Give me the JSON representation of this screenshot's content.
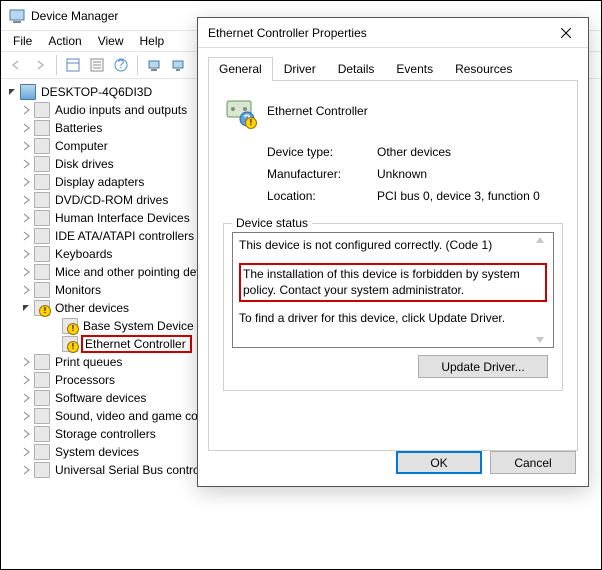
{
  "dm": {
    "title": "Device Manager",
    "menu": {
      "file": "File",
      "action": "Action",
      "view": "View",
      "help": "Help"
    },
    "root": "DESKTOP-4Q6DI3D",
    "nodes": [
      {
        "label": "Audio inputs and outputs"
      },
      {
        "label": "Batteries"
      },
      {
        "label": "Computer"
      },
      {
        "label": "Disk drives"
      },
      {
        "label": "Display adapters"
      },
      {
        "label": "DVD/CD-ROM drives"
      },
      {
        "label": "Human Interface Devices"
      },
      {
        "label": "IDE ATA/ATAPI controllers"
      },
      {
        "label": "Keyboards"
      },
      {
        "label": "Mice and other pointing devices"
      },
      {
        "label": "Monitors"
      },
      {
        "label": "Other devices",
        "expanded": true,
        "children": [
          {
            "label": "Base System Device"
          },
          {
            "label": "Ethernet Controller",
            "highlight": true
          }
        ]
      },
      {
        "label": "Print queues"
      },
      {
        "label": "Processors"
      },
      {
        "label": "Software devices"
      },
      {
        "label": "Sound, video and game controllers"
      },
      {
        "label": "Storage controllers"
      },
      {
        "label": "System devices"
      },
      {
        "label": "Universal Serial Bus controllers"
      }
    ]
  },
  "dlg": {
    "title": "Ethernet Controller Properties",
    "tabs": {
      "general": "General",
      "driver": "Driver",
      "details": "Details",
      "events": "Events",
      "resources": "Resources"
    },
    "device_name": "Ethernet Controller",
    "info": {
      "type_label": "Device type:",
      "type_value": "Other devices",
      "mfg_label": "Manufacturer:",
      "mfg_value": "Unknown",
      "loc_label": "Location:",
      "loc_value": "PCI bus 0, device 3, function 0"
    },
    "status_legend": "Device status",
    "status": {
      "line1": "This device is not configured correctly. (Code 1)",
      "line2": "The installation of this device is forbidden by system policy. Contact your system administrator.",
      "line3": "To find a driver for this device, click Update Driver."
    },
    "update_btn": "Update Driver...",
    "ok": "OK",
    "cancel": "Cancel"
  }
}
